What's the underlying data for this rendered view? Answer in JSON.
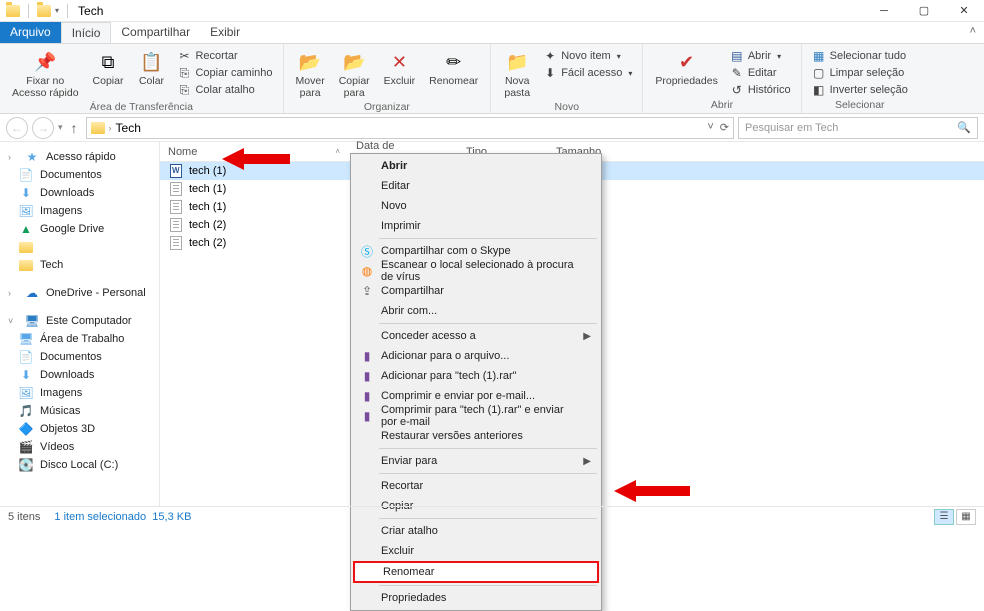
{
  "window": {
    "title": "Tech"
  },
  "tabs": {
    "file": "Arquivo",
    "home": "Início",
    "share": "Compartilhar",
    "view": "Exibir"
  },
  "ribbon": {
    "clipboard": {
      "pin": "Fixar no\nAcesso rápido",
      "copy": "Copiar",
      "paste": "Colar",
      "cut": "Recortar",
      "copypath": "Copiar caminho",
      "pasteshort": "Colar atalho",
      "label": "Área de Transferência"
    },
    "organize": {
      "moveto": "Mover\npara",
      "copyto": "Copiar\npara",
      "delete": "Excluir",
      "rename": "Renomear",
      "label": "Organizar"
    },
    "new": {
      "newfolder": "Nova\npasta",
      "newitem": "Novo item",
      "easyaccess": "Fácil acesso",
      "label": "Novo"
    },
    "open": {
      "props": "Propriedades",
      "open": "Abrir",
      "edit": "Editar",
      "history": "Histórico",
      "label": "Abrir"
    },
    "select": {
      "all": "Selecionar tudo",
      "none": "Limpar seleção",
      "invert": "Inverter seleção",
      "label": "Selecionar"
    }
  },
  "address": {
    "crumb": "Tech"
  },
  "search": {
    "placeholder": "Pesquisar em Tech"
  },
  "nav": {
    "quick": "Acesso rápido",
    "quick_items": [
      "Documentos",
      "Downloads",
      "Imagens",
      "Google Drive",
      "",
      "Tech"
    ],
    "onedrive": "OneDrive - Personal",
    "pc": "Este Computador",
    "pc_items": [
      "Área de Trabalho",
      "Documentos",
      "Downloads",
      "Imagens",
      "Músicas",
      "Objetos 3D",
      "Vídeos",
      "Disco Local (C:)"
    ]
  },
  "columns": {
    "name": "Nome",
    "date": "Data de modificação",
    "type": "Tipo",
    "size": "Tamanho"
  },
  "files": [
    {
      "name": "tech (1)",
      "kind": "docx",
      "selected": true
    },
    {
      "name": "tech (1)",
      "kind": "txt"
    },
    {
      "name": "tech (1)",
      "kind": "txt"
    },
    {
      "name": "tech (2)",
      "kind": "txt"
    },
    {
      "name": "tech (2)",
      "kind": "txt"
    }
  ],
  "context": [
    {
      "t": "Abrir",
      "bold": true
    },
    {
      "t": "Editar"
    },
    {
      "t": "Novo"
    },
    {
      "t": "Imprimir"
    },
    {
      "sep": true
    },
    {
      "t": "Compartilhar com o Skype",
      "icon": "skype"
    },
    {
      "t": "Escanear o local selecionado à procura de vírus",
      "icon": "avast"
    },
    {
      "t": "Compartilhar",
      "icon": "share"
    },
    {
      "t": "Abrir com..."
    },
    {
      "sep": true
    },
    {
      "t": "Conceder acesso a",
      "sub": true
    },
    {
      "t": "Adicionar para o arquivo...",
      "icon": "rar"
    },
    {
      "t": "Adicionar para \"tech (1).rar\"",
      "icon": "rar"
    },
    {
      "t": "Comprimir e enviar por e-mail...",
      "icon": "rar"
    },
    {
      "t": "Comprimir para \"tech (1).rar\" e enviar por e-mail",
      "icon": "rar"
    },
    {
      "t": "Restaurar versões anteriores"
    },
    {
      "sep": true
    },
    {
      "t": "Enviar para",
      "sub": true
    },
    {
      "sep": true
    },
    {
      "t": "Recortar"
    },
    {
      "t": "Copiar"
    },
    {
      "sep": true
    },
    {
      "t": "Criar atalho"
    },
    {
      "t": "Excluir"
    },
    {
      "t": "Renomear",
      "hl": true
    },
    {
      "sep": true
    },
    {
      "t": "Propriedades"
    }
  ],
  "status": {
    "count": "5 itens",
    "sel": "1 item selecionado",
    "size": "15,3 KB"
  }
}
